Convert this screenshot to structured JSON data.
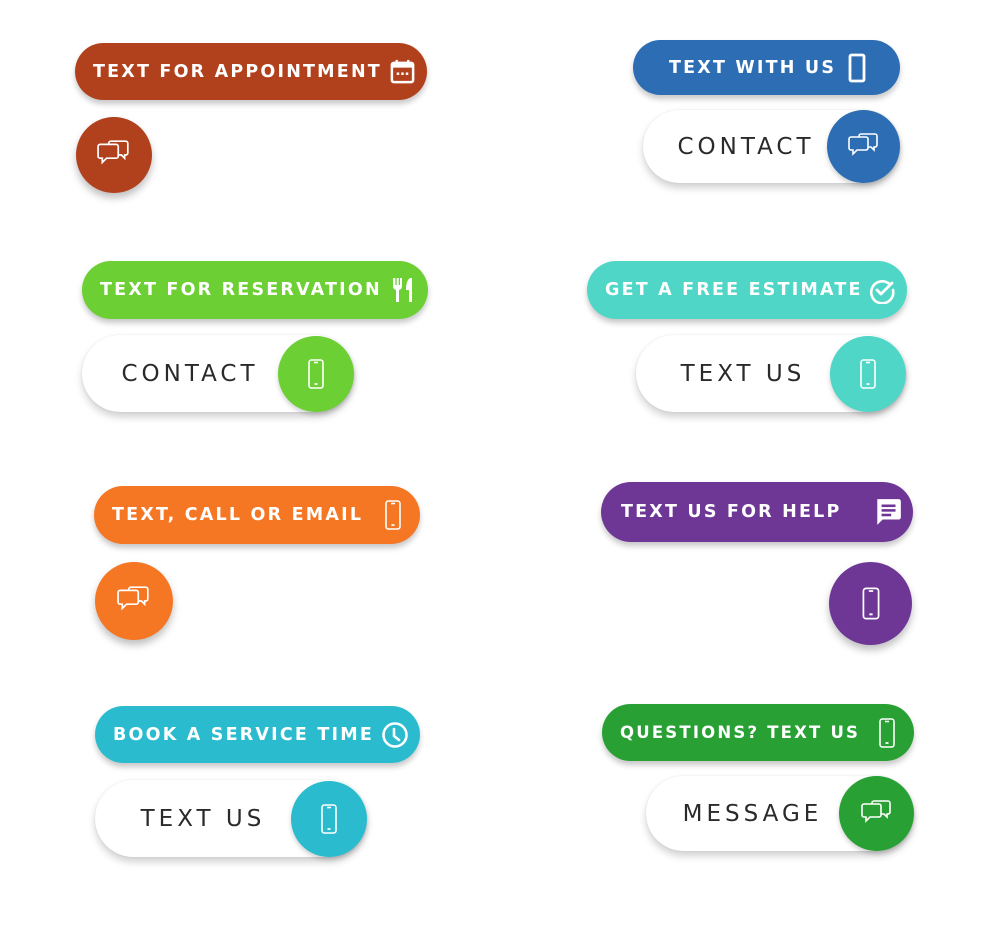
{
  "colors": {
    "rust": "#B1401C",
    "blue": "#2D6DB3",
    "lime": "#6CCF33",
    "teal": "#4FD6C6",
    "orange": "#F57623",
    "purple": "#6E3795",
    "cyan": "#2ABCCE",
    "green": "#28A034"
  },
  "groups": [
    {
      "primary": {
        "label": "TEXT FOR APPOINTMENT",
        "icon": "calendar-icon"
      },
      "secondary": {
        "type": "fab",
        "icon": "chat-bubbles-icon"
      }
    },
    {
      "primary": {
        "label": "TEXT WITH US",
        "icon": "phone-icon"
      },
      "secondary": {
        "type": "pill",
        "label": "CONTACT",
        "icon": "chat-bubbles-icon"
      }
    },
    {
      "primary": {
        "label": "TEXT FOR RESERVATION",
        "icon": "fork-knife-icon"
      },
      "secondary": {
        "type": "pill",
        "label": "CONTACT",
        "icon": "smartphone-icon"
      }
    },
    {
      "primary": {
        "label": "GET A FREE ESTIMATE",
        "icon": "check-circle-icon"
      },
      "secondary": {
        "type": "pill",
        "label": "TEXT US",
        "icon": "smartphone-icon"
      }
    },
    {
      "primary": {
        "label": "TEXT, CALL OR EMAIL",
        "icon": "smartphone-icon"
      },
      "secondary": {
        "type": "fab",
        "icon": "chat-bubbles-icon"
      }
    },
    {
      "primary": {
        "label": "TEXT US FOR HELP",
        "icon": "message-icon"
      },
      "secondary": {
        "type": "fab",
        "icon": "smartphone-icon"
      }
    },
    {
      "primary": {
        "label": "BOOK A SERVICE TIME",
        "icon": "clock-icon"
      },
      "secondary": {
        "type": "pill",
        "label": "TEXT US",
        "icon": "smartphone-icon"
      }
    },
    {
      "primary": {
        "label": "QUESTIONS? TEXT US",
        "icon": "smartphone-icon"
      },
      "secondary": {
        "type": "pill",
        "label": "MESSAGE",
        "icon": "chat-bubbles-icon"
      }
    }
  ]
}
